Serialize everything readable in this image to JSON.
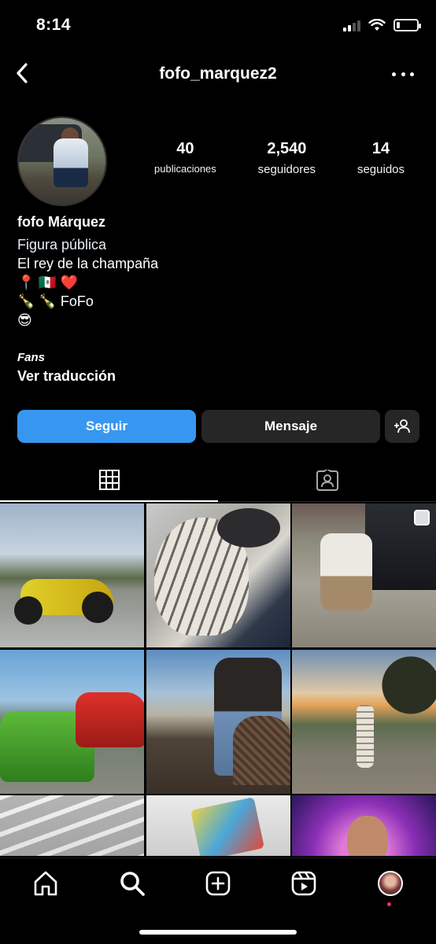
{
  "status_bar": {
    "time": "8:14"
  },
  "header": {
    "username": "fofo_marquez2"
  },
  "stats": {
    "posts": {
      "value": "40",
      "label": "publicaciones"
    },
    "followers": {
      "value": "2,540",
      "label": "seguidores"
    },
    "following": {
      "value": "14",
      "label": "seguidos"
    }
  },
  "bio": {
    "name": "fofo Márquez",
    "category": "Figura pública",
    "line1": "El rey de la champaña",
    "line2": "📍 🇲🇽 ❤️",
    "line3": "🍾 🍾 FoFo",
    "line4": "😎",
    "highlight_label": "Fans",
    "translate": "Ver traducción"
  },
  "actions": {
    "follow": "Seguir",
    "message": "Mensaje"
  },
  "colors": {
    "follow_button": "#3797f0",
    "secondary_button": "#262626",
    "background": "#000000",
    "notification_dot": "#ff2a5f"
  },
  "tabs": [
    {
      "icon": "grid-icon"
    },
    {
      "icon": "tagged-icon"
    }
  ],
  "grid": [
    {
      "icon": "post-photo"
    },
    {
      "icon": "post-photo"
    },
    {
      "icon": "post-photo",
      "multi": true
    },
    {
      "icon": "post-photo"
    },
    {
      "icon": "post-photo"
    },
    {
      "icon": "post-photo"
    },
    {
      "icon": "post-photo"
    },
    {
      "icon": "post-photo"
    },
    {
      "icon": "post-photo"
    }
  ],
  "bottom_nav": [
    "home-icon",
    "search-icon",
    "create-icon",
    "reels-icon",
    "profile-avatar"
  ]
}
